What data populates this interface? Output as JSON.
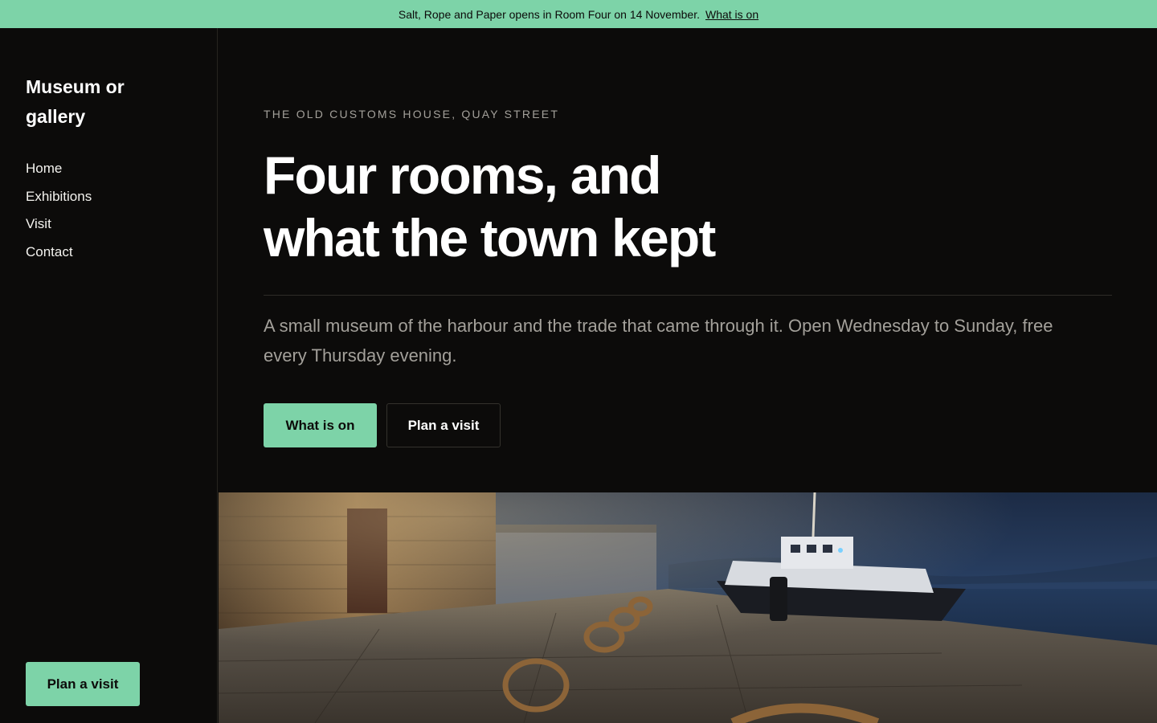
{
  "announcement": {
    "text": "Salt, Rope and Paper opens in Room Four on 14 November.",
    "link_label": "What is on"
  },
  "sidebar": {
    "brand": "Museum or gallery",
    "nav": [
      {
        "label": "Home"
      },
      {
        "label": "Exhibitions"
      },
      {
        "label": "Visit"
      },
      {
        "label": "Contact"
      }
    ],
    "cta_label": "Plan a visit"
  },
  "hero": {
    "eyebrow": "THE OLD CUSTOMS HOUSE, QUAY STREET",
    "headline_line1": "Four rooms, and",
    "headline_line2": "what the town kept",
    "lede": "A small museum of the harbour and the trade that came through it. Open Wednesday to Sunday, free every Thursday evening.",
    "primary_label": "What is on",
    "secondary_label": "Plan a visit"
  },
  "colors": {
    "accent": "#7dd3a8",
    "background": "#0c0b0a",
    "muted_text": "#a3a09a"
  }
}
